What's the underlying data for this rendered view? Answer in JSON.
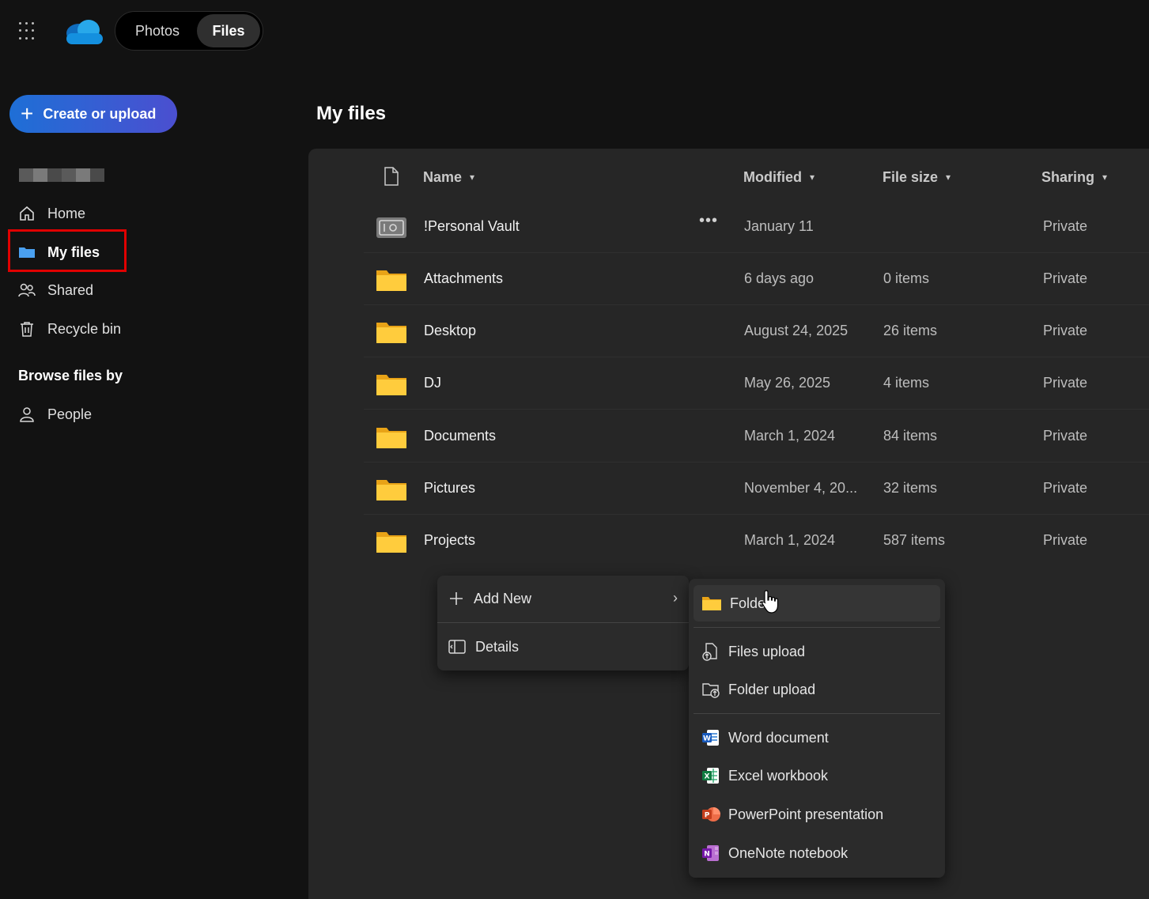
{
  "topbar": {
    "apps_icon": "waffle-icon",
    "logo_icon": "onedrive-cloud-icon",
    "tabs": [
      {
        "label": "Photos",
        "active": false
      },
      {
        "label": "Files",
        "active": true
      }
    ]
  },
  "sidebar": {
    "create_label": "Create or upload",
    "nav": [
      {
        "label": "Home",
        "icon": "home-icon"
      },
      {
        "label": "My files",
        "icon": "folder-icon",
        "active": true
      },
      {
        "label": "Shared",
        "icon": "people-icon"
      },
      {
        "label": "Recycle bin",
        "icon": "trash-icon"
      }
    ],
    "browse_title": "Browse files by",
    "browse": [
      {
        "label": "People",
        "icon": "person-icon"
      }
    ]
  },
  "main": {
    "title": "My files",
    "columns": {
      "name": "Name",
      "modified": "Modified",
      "size": "File size",
      "sharing": "Sharing"
    },
    "rows": [
      {
        "name": "!Personal Vault",
        "modified": "January 11",
        "size": "",
        "sharing": "Private",
        "icon": "vault-icon"
      },
      {
        "name": "Attachments",
        "modified": "6 days ago",
        "size": "0 items",
        "sharing": "Private",
        "icon": "folder-icon"
      },
      {
        "name": "Desktop",
        "modified": "August 24, 2025",
        "size": "26 items",
        "sharing": "Private",
        "icon": "folder-icon"
      },
      {
        "name": "DJ",
        "modified": "May 26, 2025",
        "size": "4 items",
        "sharing": "Private",
        "icon": "folder-icon"
      },
      {
        "name": "Documents",
        "modified": "March 1, 2024",
        "size": "84 items",
        "sharing": "Private",
        "icon": "folder-icon"
      },
      {
        "name": "Pictures",
        "modified": "November 4, 20...",
        "size": "32 items",
        "sharing": "Private",
        "icon": "folder-icon"
      },
      {
        "name": "Projects",
        "modified": "March 1, 2024",
        "size": "587 items",
        "sharing": "Private",
        "icon": "folder-icon"
      }
    ]
  },
  "context_menu": {
    "add_new": "Add New",
    "details": "Details"
  },
  "submenu": {
    "items": [
      {
        "label": "Folder",
        "icon": "folder-icon"
      },
      {
        "label": "Files upload",
        "icon": "file-upload-icon"
      },
      {
        "label": "Folder upload",
        "icon": "folder-upload-icon"
      },
      {
        "label": "Word document",
        "icon": "word-icon"
      },
      {
        "label": "Excel workbook",
        "icon": "excel-icon"
      },
      {
        "label": "PowerPoint presentation",
        "icon": "powerpoint-icon"
      },
      {
        "label": "OneNote notebook",
        "icon": "onenote-icon"
      }
    ]
  },
  "colors": {
    "accent": "#1e6fd6",
    "highlight": "#e00000",
    "folder": "#f5c33b"
  }
}
